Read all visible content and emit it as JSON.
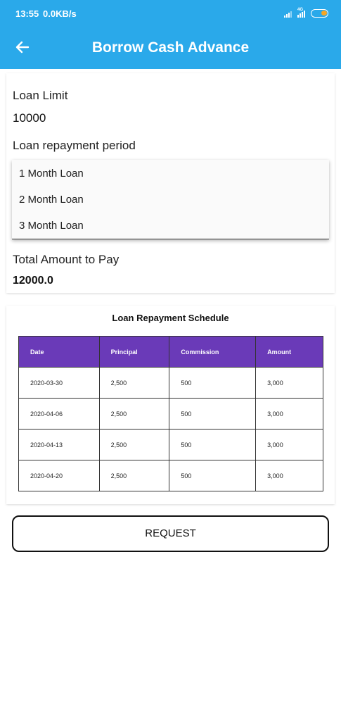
{
  "status_bar": {
    "time": "13:55",
    "network_speed": "0.0KB/s",
    "signal_icon": "signal-icon",
    "wifi_icon": "signal-4g-icon",
    "battery_icon": "battery-icon",
    "network_label": "4G"
  },
  "app_bar": {
    "title": "Borrow Cash Advance",
    "back_icon": "arrow-left-icon",
    "color": "#2aa9ea"
  },
  "loan": {
    "limit_label": "Loan Limit",
    "limit_value": "10000",
    "period_label": "Loan repayment period",
    "period_options": [
      "1 Month Loan",
      "2 Month Loan",
      "3 Month Loan"
    ],
    "total_label": "Total Amount to Pay",
    "total_value": "12000.0"
  },
  "schedule": {
    "title": "Loan Repayment Schedule",
    "header_color": "#6a3ab8",
    "columns": [
      "Date",
      "Principal",
      "Commission",
      "Amount"
    ],
    "rows": [
      [
        "2020-03-30",
        "2,500",
        "500",
        "3,000"
      ],
      [
        "2020-04-06",
        "2,500",
        "500",
        "3,000"
      ],
      [
        "2020-04-13",
        "2,500",
        "500",
        "3,000"
      ],
      [
        "2020-04-20",
        "2,500",
        "500",
        "3,000"
      ]
    ]
  },
  "actions": {
    "request_label": "REQUEST"
  }
}
